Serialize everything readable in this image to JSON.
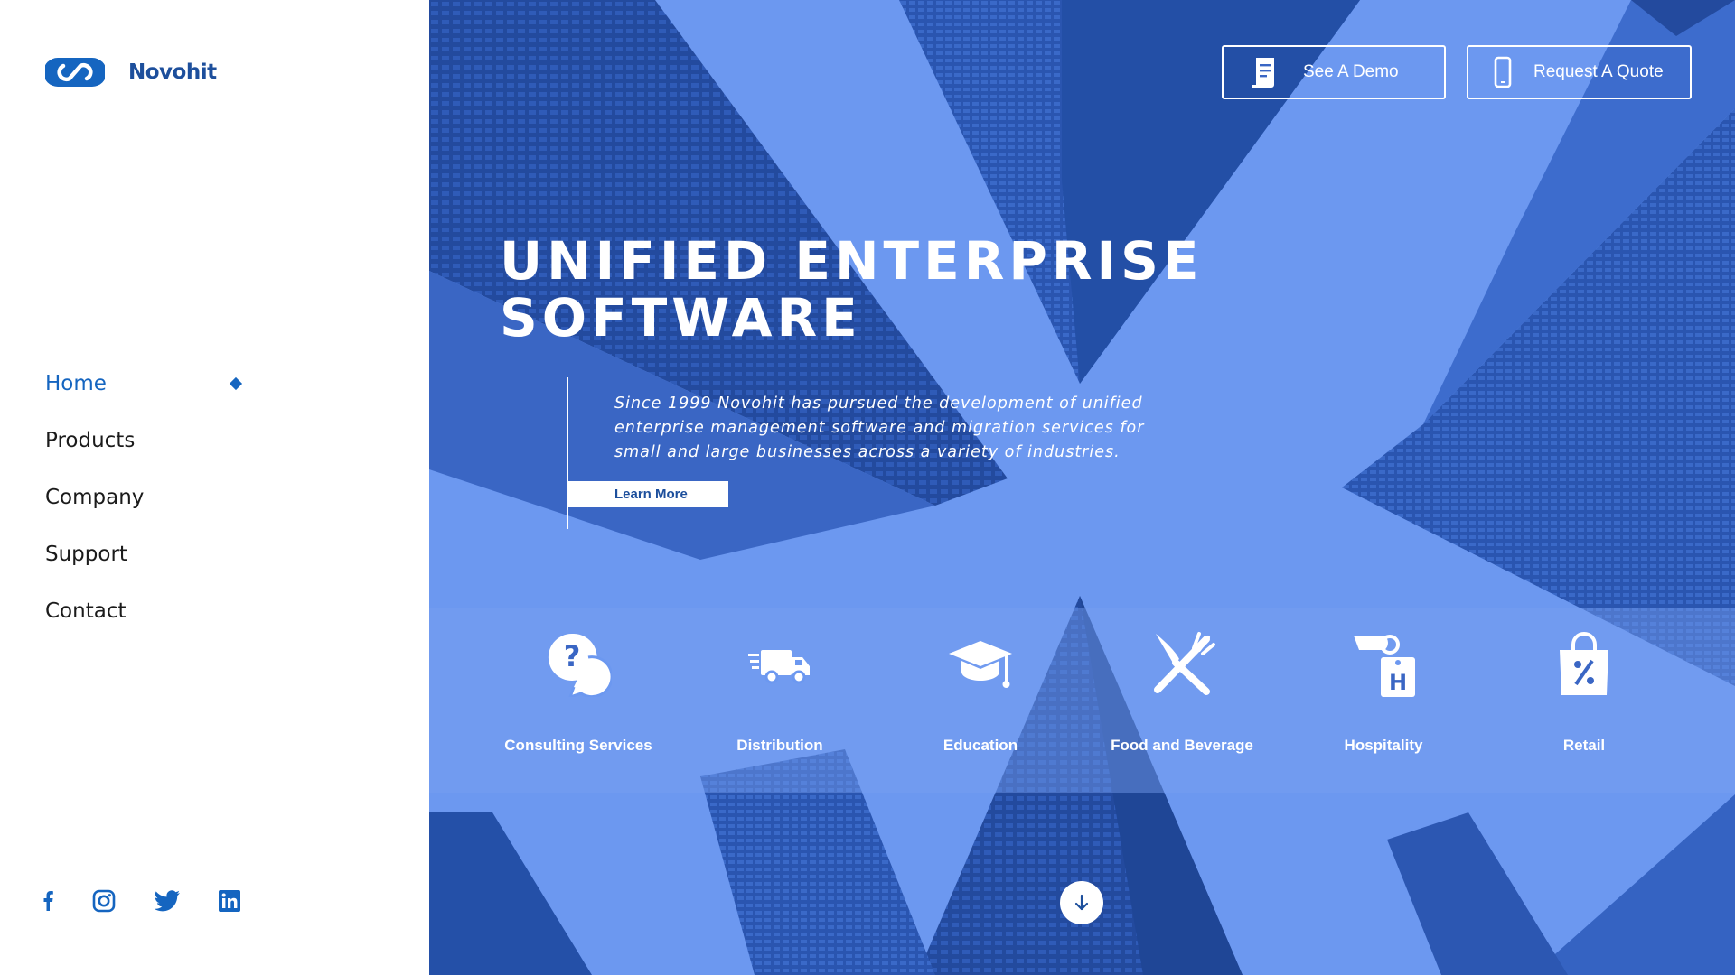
{
  "brand": {
    "name": "Novohit",
    "accent": "#1565c0",
    "dark_accent": "#1d4f9c",
    "hero_tint": "#6a97f0"
  },
  "nav": {
    "items": [
      {
        "label": "Home",
        "active": true
      },
      {
        "label": "Products",
        "active": false
      },
      {
        "label": "Company",
        "active": false
      },
      {
        "label": "Support",
        "active": false
      },
      {
        "label": "Contact",
        "active": false
      }
    ]
  },
  "social": [
    "facebook-icon",
    "instagram-icon",
    "twitter-icon",
    "linkedin-icon"
  ],
  "header": {
    "demo_label": "See A Demo",
    "demo_icon": "document-icon",
    "quote_label": "Request A Quote",
    "quote_icon": "phone-icon"
  },
  "hero": {
    "headline_line1": "Unified Enterprise",
    "headline_line2": "Software",
    "description": "Since 1999 Novohit has pursued the development of unified enterprise management software and migration services for small and large businesses across a variety of industries.",
    "cta_label": "Learn More"
  },
  "industries": [
    {
      "label": "Consulting Services",
      "icon": "chat-question-icon"
    },
    {
      "label": "Distribution",
      "icon": "delivery-truck-icon"
    },
    {
      "label": "Education",
      "icon": "graduation-cap-icon"
    },
    {
      "label": "Food and Beverage",
      "icon": "fork-knife-icon"
    },
    {
      "label": "Hospitality",
      "icon": "hotel-tag-icon"
    },
    {
      "label": "Retail",
      "icon": "shopping-bag-percent-icon"
    }
  ],
  "scroll_icon": "arrow-down-icon"
}
